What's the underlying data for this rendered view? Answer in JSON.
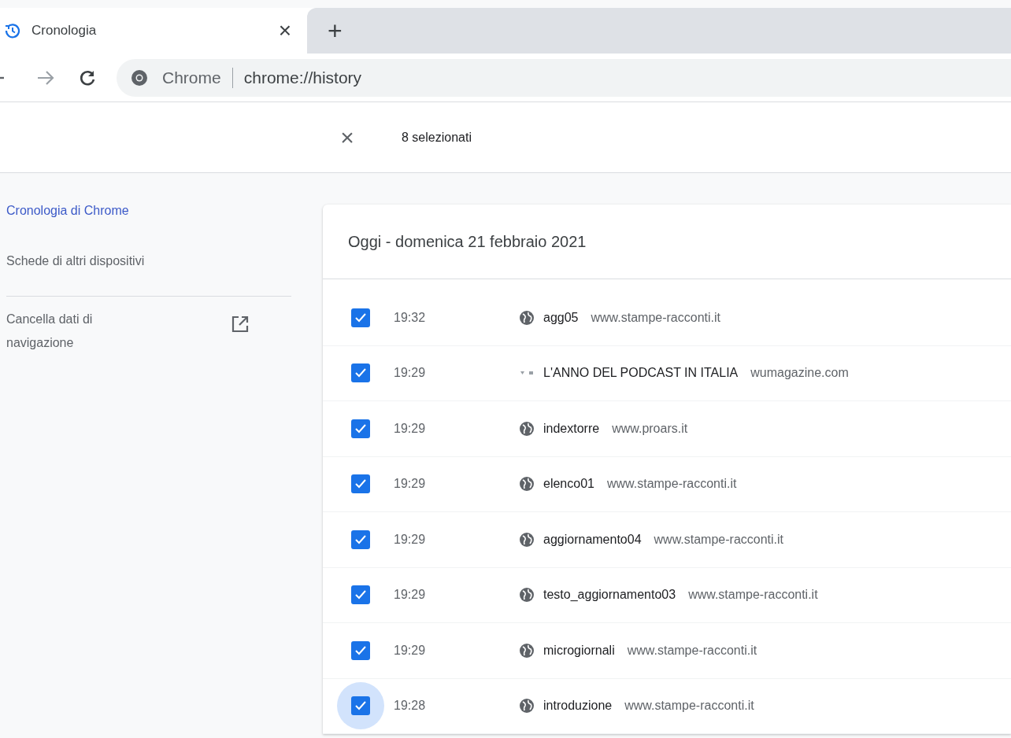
{
  "tab": {
    "title": "Cronologia",
    "close": "×",
    "new_tab": "+"
  },
  "toolbar": {
    "site_label": "Chrome",
    "url": "chrome://history"
  },
  "selection_bar": {
    "close": "×",
    "count": "8 selezionati"
  },
  "sidebar": {
    "items": [
      {
        "label": "Cronologia di Chrome",
        "selected": true
      },
      {
        "label": "Schede di altri dispositivi",
        "selected": false
      }
    ],
    "clear_data": "Cancella dati di navigazione"
  },
  "history": {
    "date": "Oggi - domenica 21 febbraio 2021",
    "rows": [
      {
        "checked": true,
        "focused": false,
        "time": "19:32",
        "kind": "globe",
        "title": "agg05",
        "domain": "www.stampe-racconti.it"
      },
      {
        "checked": true,
        "focused": false,
        "time": "19:29",
        "kind": "dots",
        "title": "L'ANNO DEL PODCAST IN ITALIA",
        "domain": "wumagazine.com"
      },
      {
        "checked": true,
        "focused": false,
        "time": "19:29",
        "kind": "globe",
        "title": "indextorre",
        "domain": "www.proars.it"
      },
      {
        "checked": true,
        "focused": false,
        "time": "19:29",
        "kind": "globe",
        "title": "elenco01",
        "domain": "www.stampe-racconti.it"
      },
      {
        "checked": true,
        "focused": false,
        "time": "19:29",
        "kind": "globe",
        "title": "aggiornamento04",
        "domain": "www.stampe-racconti.it"
      },
      {
        "checked": true,
        "focused": false,
        "time": "19:29",
        "kind": "globe",
        "title": "testo_aggiornamento03",
        "domain": "www.stampe-racconti.it"
      },
      {
        "checked": true,
        "focused": false,
        "time": "19:29",
        "kind": "globe",
        "title": "microgiornali",
        "domain": "www.stampe-racconti.it"
      },
      {
        "checked": true,
        "focused": true,
        "time": "19:28",
        "kind": "globe",
        "title": "introduzione",
        "domain": "www.stampe-racconti.it"
      }
    ]
  }
}
